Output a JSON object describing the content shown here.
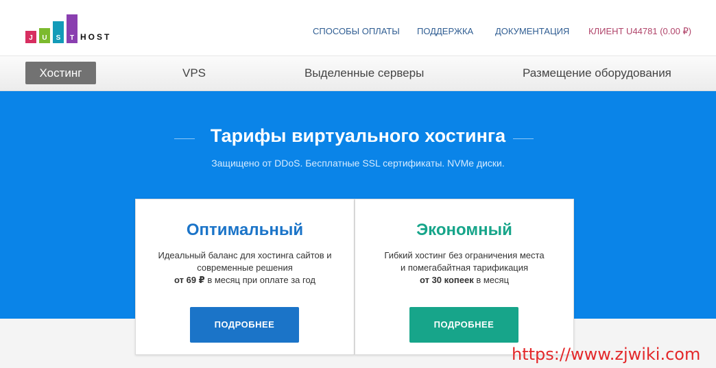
{
  "logo": {
    "letters": [
      "J",
      "U",
      "S",
      "T"
    ],
    "host_text": "HOST",
    "colors": [
      "#d72e60",
      "#7cba2e",
      "#139bb8",
      "#8a3fb0"
    ]
  },
  "top_nav": {
    "payment": "СПОСОБЫ ОПЛАТЫ",
    "support": "ПОДДЕРЖКА",
    "docs": "ДОКУМЕНТАЦИЯ",
    "client": "КЛИЕНТ U44781 (0.00 ₽)"
  },
  "tabs": [
    {
      "label": "Хостинг",
      "active": true
    },
    {
      "label": "VPS",
      "active": false
    },
    {
      "label": "Выделенные серверы",
      "active": false
    },
    {
      "label": "Размещение оборудования",
      "active": false
    }
  ],
  "hero": {
    "title": "Тарифы виртуального хостинга",
    "subtitle": "Защищено от DDoS. Бесплатные SSL сертификаты. NVMe диски."
  },
  "plans": [
    {
      "title": "Оптимальный",
      "desc_line1": "Идеальный баланс для хостинга сайтов и",
      "desc_line2": "современные решения",
      "price_bold": "от 69 ₽",
      "price_rest": " в месяц при оплате за год",
      "button": "ПОДРОБНЕЕ",
      "color": "#1b74c8"
    },
    {
      "title": "Экономный",
      "desc_line1": "Гибкий хостинг без ограничения места",
      "desc_line2": "и помегабайтная тарификация",
      "price_bold": "от 30 копеек",
      "price_rest": " в месяц",
      "button": "ПОДРОБНЕЕ",
      "color": "#17a58a"
    }
  ],
  "watermark": "https://www.zjwiki.com",
  "colors": {
    "hero_bg": "#0a84e8",
    "nav_link": "#2f5d92",
    "client_link": "#b0446a",
    "active_tab": "#727272"
  }
}
